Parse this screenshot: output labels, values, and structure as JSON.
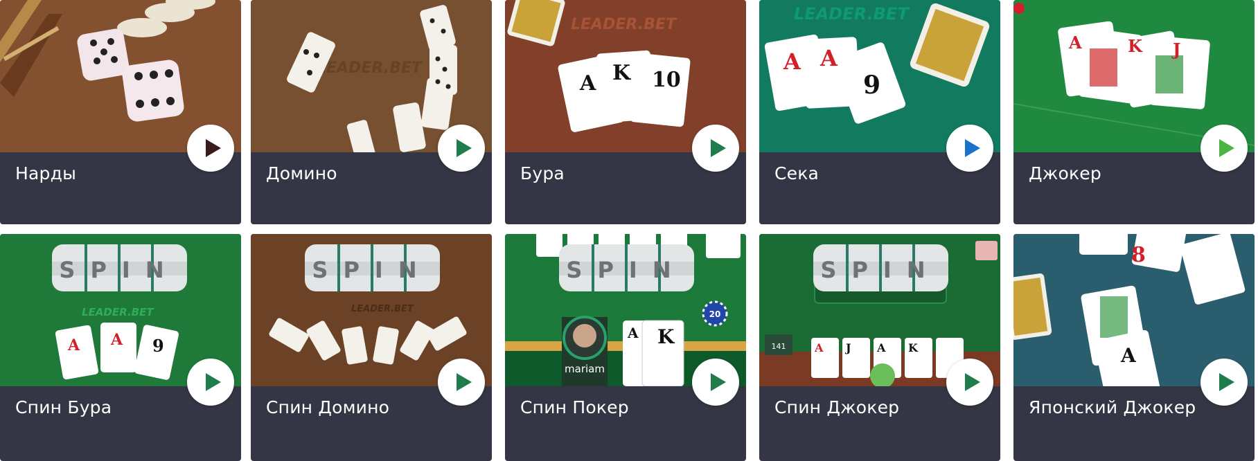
{
  "games": [
    {
      "title": "Нарды",
      "play_color": "#3a1c1c",
      "scene": "backgammon"
    },
    {
      "title": "Домино",
      "play_color": "#1e7d4b",
      "scene": "domino",
      "logo": "LEADER.BET"
    },
    {
      "title": "Бура",
      "play_color": "#1e7d4b",
      "scene": "bura",
      "logo": "LEADER.BET",
      "cards": [
        "A",
        "K",
        "10"
      ]
    },
    {
      "title": "Сека",
      "play_color": "#1a73c9",
      "scene": "seka",
      "logo": "LEADER.BET",
      "cards": [
        "A",
        "A",
        "9"
      ]
    },
    {
      "title": "Джокер",
      "play_color": "#4bb543",
      "scene": "joker",
      "cards": [
        "A",
        "K",
        "J"
      ]
    },
    {
      "title": "Спин Бура",
      "play_color": "#1e7d4b",
      "scene": "spin-bura",
      "logo": "LEADER.BET",
      "spin": "SPIN",
      "cards": [
        "A",
        "A",
        "9"
      ]
    },
    {
      "title": "Спин Домино",
      "play_color": "#1e7d4b",
      "scene": "spin-domino",
      "logo": "LEADER.BET",
      "spin": "SPIN"
    },
    {
      "title": "Спин Покер",
      "play_color": "#1e7d4b",
      "scene": "spin-poker",
      "spin": "SPIN",
      "player": "mariam",
      "chip": "20",
      "cards": [
        "A",
        "K"
      ]
    },
    {
      "title": "Спин Джокер",
      "play_color": "#1e7d4b",
      "scene": "spin-joker",
      "spin": "SPIN",
      "score": "141",
      "cards": [
        "A",
        "J",
        "A",
        "K"
      ]
    },
    {
      "title": "Японский Джокер",
      "play_color": "#1e7d4b",
      "scene": "japanese-joker",
      "cards": [
        "8",
        "A"
      ]
    }
  ]
}
